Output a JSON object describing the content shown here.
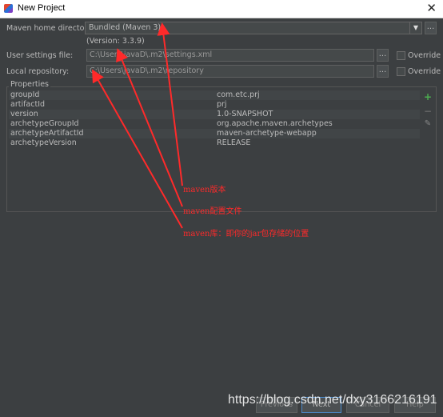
{
  "window": {
    "title": "New Project",
    "close_glyph": "✕"
  },
  "maven_home": {
    "label": "Maven home directory:",
    "value": "Bundled (Maven 3)",
    "version": "(Version: 3.3.9)"
  },
  "user_settings": {
    "label": "User settings file:",
    "value": "C:\\Users\\javaD\\.m2\\settings.xml",
    "override": "Override"
  },
  "local_repo": {
    "label": "Local repository:",
    "value": "C:\\Users\\javaD\\.m2\\repository",
    "override": "Override"
  },
  "browse_label": "...",
  "properties": {
    "title": "Properties",
    "rows": [
      {
        "key": "groupId",
        "value": "com.etc.prj"
      },
      {
        "key": "artifactId",
        "value": "prj"
      },
      {
        "key": "version",
        "value": "1.0-SNAPSHOT"
      },
      {
        "key": "archetypeGroupId",
        "value": "org.apache.maven.archetypes"
      },
      {
        "key": "archetypeArtifactId",
        "value": "maven-archetype-webapp"
      },
      {
        "key": "archetypeVersion",
        "value": "RELEASE"
      }
    ],
    "add_glyph": "+",
    "remove_glyph": "−",
    "edit_glyph": "✎"
  },
  "annotations": [
    "maven版本",
    "maven配置文件",
    "maven库：即你的jar包存储的位置"
  ],
  "buttons": {
    "previous": "Previous",
    "next": "Next",
    "cancel": "Cancel",
    "help": "Help"
  },
  "watermark": "https://blog.csdn.net/dxy3166216191",
  "colors": {
    "annotation": "#ff2a2a",
    "add_icon": "#4caf50",
    "background": "#3c3f41"
  },
  "icons": [
    "app-icon",
    "close-icon",
    "dropdown-arrow-icon",
    "add-icon",
    "remove-icon",
    "edit-icon"
  ]
}
